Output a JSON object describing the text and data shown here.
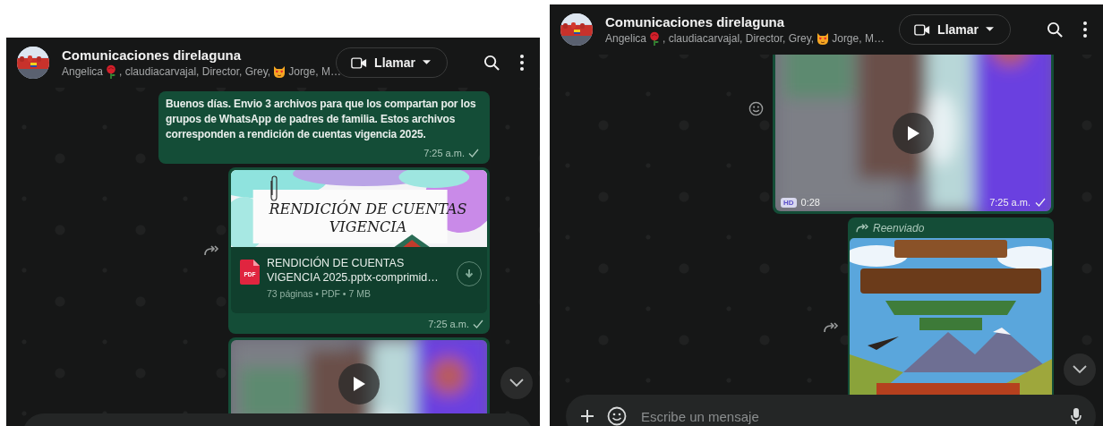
{
  "panels": [
    {
      "header": {
        "title": "Comunicaciones direlaguna",
        "participants": [
          "Angelica",
          " , claudiacarvajal, Director, Grey,",
          "Jorge, M…"
        ],
        "call_button": "Llamar"
      },
      "messages": [
        {
          "kind": "text",
          "text": "Buenos días. Envio 3 archivos para que los compartan por los grupos de WhatsApp de padres de familia. Estos archivos corresponden a rendición de cuentas vigencia 2025.",
          "time": "7:25 a.m."
        },
        {
          "kind": "document",
          "forward_button": true,
          "preview_text": "RENDICIÓN DE CUENTAS VIGENCIA",
          "file_badge": "PDF",
          "file_name": "RENDICIÓN DE CUENTAS VIGENCIA 2025.pptx-comprimid…",
          "meta": "73 páginas • PDF • 7 MB",
          "time": "7:25 a.m."
        },
        {
          "kind": "video"
        }
      ]
    },
    {
      "header": {
        "title": "Comunicaciones direlaguna",
        "participants": [
          "Angelica",
          " , claudiacarvajal, Director, Grey,",
          "Jorge, M…"
        ],
        "call_button": "Llamar"
      },
      "messages": [
        {
          "kind": "video",
          "react_button": true,
          "badge": "HD",
          "duration": "0:28",
          "time": "7:25 a.m."
        },
        {
          "forward_button": true,
          "forwarded_label": "Reenviado"
        }
      ],
      "composer": {
        "placeholder": "Escribe un mensaje"
      }
    }
  ]
}
